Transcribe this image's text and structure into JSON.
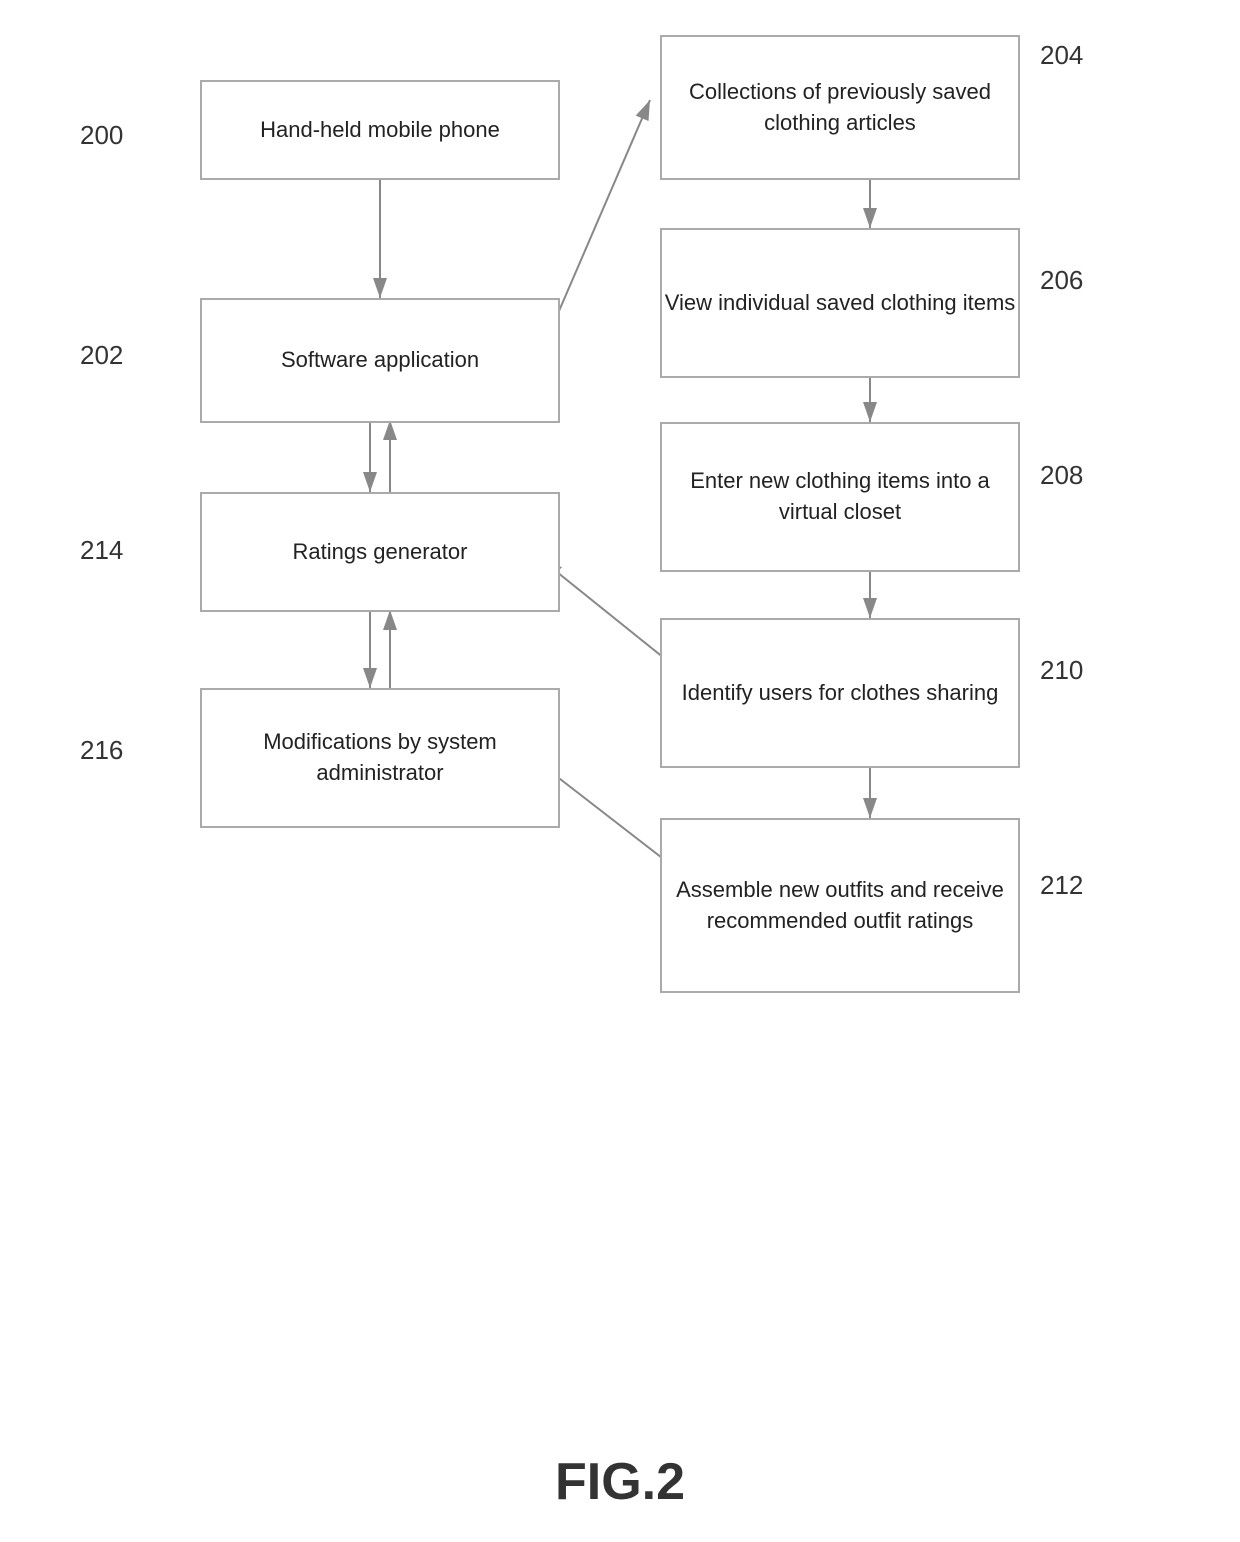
{
  "figure": {
    "caption": "FIG.2"
  },
  "labels": {
    "n200": "200",
    "n202": "202",
    "n204": "204",
    "n206": "206",
    "n208": "208",
    "n210": "210",
    "n212": "212",
    "n214": "214",
    "n216": "216"
  },
  "boxes": {
    "box200": "Hand-held mobile phone",
    "box202": "Software application",
    "box204": "Collections of previously saved clothing articles",
    "box206": "View individual saved clothing items",
    "box208": "Enter new clothing items into a virtual closet",
    "box210": "Identify users for clothes sharing",
    "box212": "Assemble new outfits and receive recommended outfit ratings",
    "box214": "Ratings generator",
    "box216": "Modifications by system administrator"
  }
}
